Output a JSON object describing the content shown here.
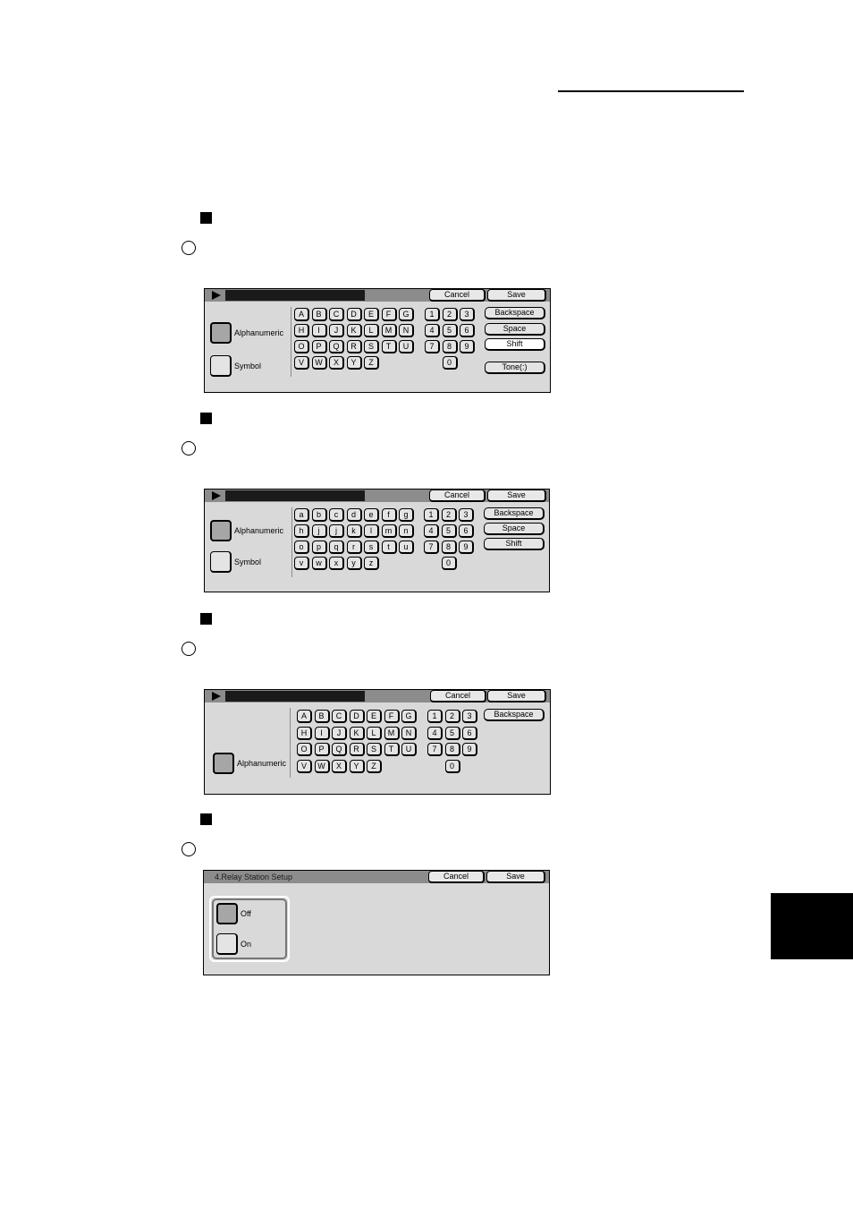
{
  "panels": [
    {
      "title": "",
      "header_buttons": {
        "cancel": "Cancel",
        "save": "Save"
      },
      "modes": [
        "Alphanumeric",
        "Symbol"
      ],
      "selected_mode": "Alphanumeric",
      "letter_rows": [
        [
          "A",
          "B",
          "C",
          "D",
          "E",
          "F",
          "G"
        ],
        [
          "H",
          "I",
          "J",
          "K",
          "L",
          "M",
          "N"
        ],
        [
          "O",
          "P",
          "Q",
          "R",
          "S",
          "T",
          "U"
        ],
        [
          "V",
          "W",
          "X",
          "Y",
          "Z"
        ]
      ],
      "number_rows": [
        [
          "1",
          "2",
          "3"
        ],
        [
          "4",
          "5",
          "6"
        ],
        [
          "7",
          "8",
          "9"
        ],
        [
          "0"
        ]
      ],
      "function_buttons": [
        "Backspace",
        "Space",
        "Shift",
        "Tone(:)"
      ],
      "active_function": "Shift"
    },
    {
      "title": "",
      "header_buttons": {
        "cancel": "Cancel",
        "save": "Save"
      },
      "modes": [
        "Alphanumeric",
        "Symbol"
      ],
      "selected_mode": "Alphanumeric",
      "letter_rows": [
        [
          "a",
          "b",
          "c",
          "d",
          "e",
          "f",
          "g"
        ],
        [
          "h",
          "j",
          "j",
          "k",
          "l",
          "m",
          "n"
        ],
        [
          "o",
          "p",
          "q",
          "r",
          "s",
          "t",
          "u"
        ],
        [
          "v",
          "w",
          "x",
          "y",
          "z"
        ]
      ],
      "number_rows": [
        [
          "1",
          "2",
          "3"
        ],
        [
          "4",
          "5",
          "6"
        ],
        [
          "7",
          "8",
          "9"
        ],
        [
          "0"
        ]
      ],
      "function_buttons": [
        "Backspace",
        "Space",
        "Shift"
      ],
      "active_function": ""
    },
    {
      "title": "",
      "header_buttons": {
        "cancel": "Cancel",
        "save": "Save"
      },
      "modes": [
        "Alphanumeric"
      ],
      "selected_mode": "Alphanumeric",
      "letter_rows": [
        [
          "A",
          "B",
          "C",
          "D",
          "E",
          "F",
          "G"
        ],
        [
          "H",
          "I",
          "J",
          "K",
          "L",
          "M",
          "N"
        ],
        [
          "O",
          "P",
          "Q",
          "R",
          "S",
          "T",
          "U"
        ],
        [
          "V",
          "W",
          "X",
          "Y",
          "Z"
        ]
      ],
      "number_rows": [
        [
          "1",
          "2",
          "3"
        ],
        [
          "4",
          "5",
          "6"
        ],
        [
          "7",
          "8",
          "9"
        ],
        [
          "0"
        ]
      ],
      "function_buttons": [
        "Backspace"
      ],
      "active_function": ""
    },
    {
      "title": "4.Relay Station Setup",
      "header_buttons": {
        "cancel": "Cancel",
        "save": "Save"
      },
      "options": [
        "Off",
        "On"
      ],
      "selected_option": "Off"
    }
  ],
  "icons": {
    "section_marker": "black-square",
    "step_marker": "circle",
    "title_arrow": "play-triangle"
  }
}
